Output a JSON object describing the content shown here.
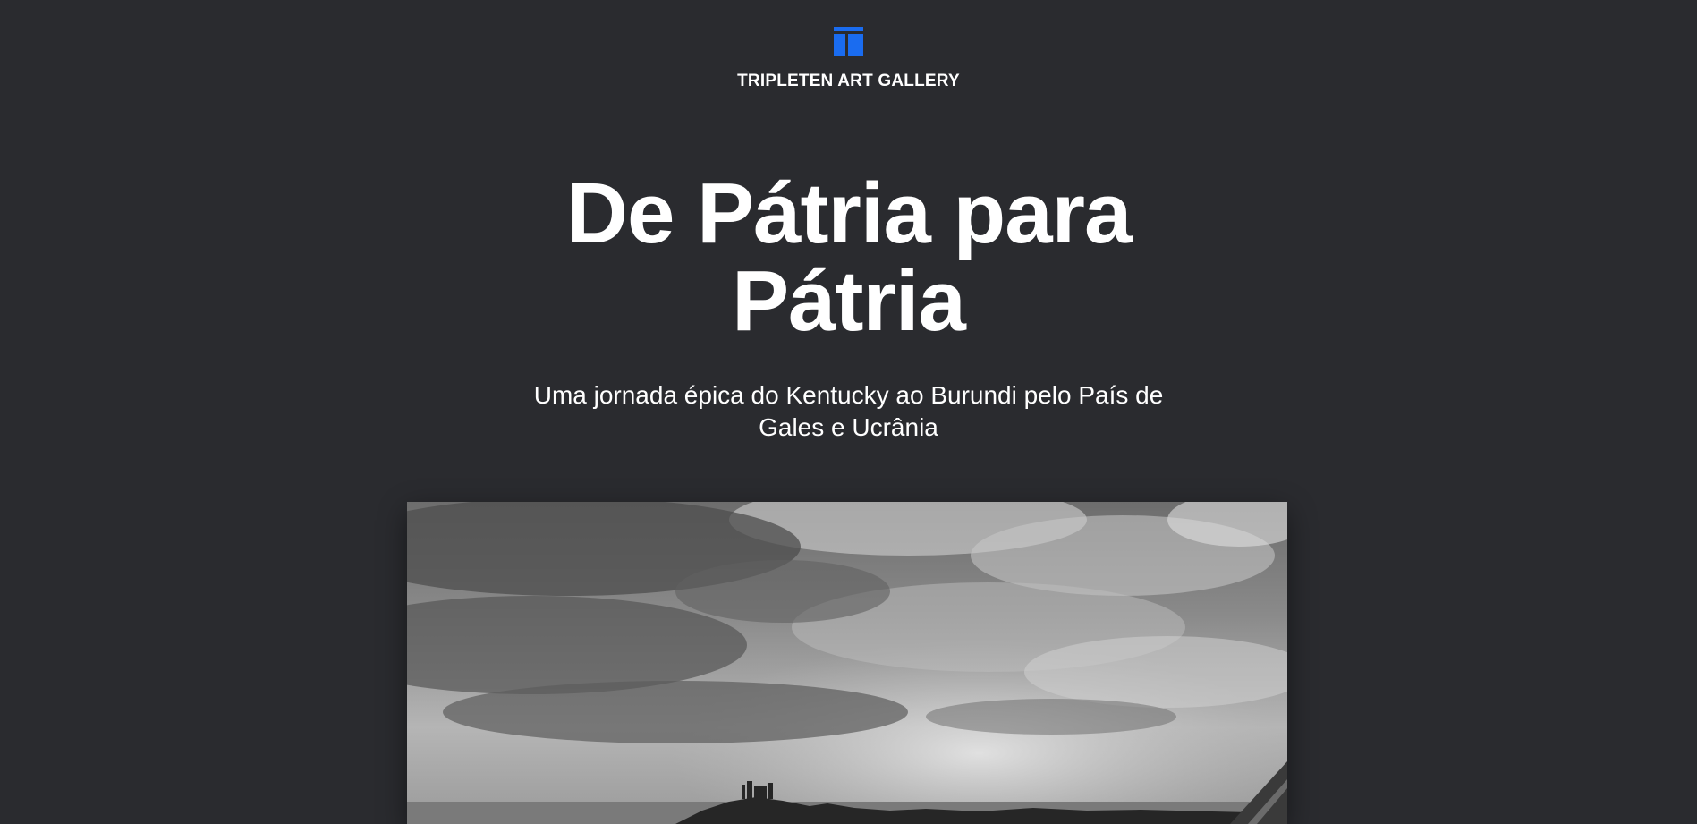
{
  "header": {
    "logo_icon": "gallery-logo-icon",
    "brand": "TRIPLETEN ART GALLERY",
    "accent_color": "#1a6cf0"
  },
  "hero": {
    "title": "De Pátria para Pátria",
    "subtitle": "Uma jornada épica do Kentucky ao Burundi pelo País de Gales e Ucrânia"
  },
  "cover": {
    "image": "black-and-white-coastal-landscape-photo"
  },
  "colors": {
    "background": "#2a2b2f",
    "text": "#ffffff"
  }
}
